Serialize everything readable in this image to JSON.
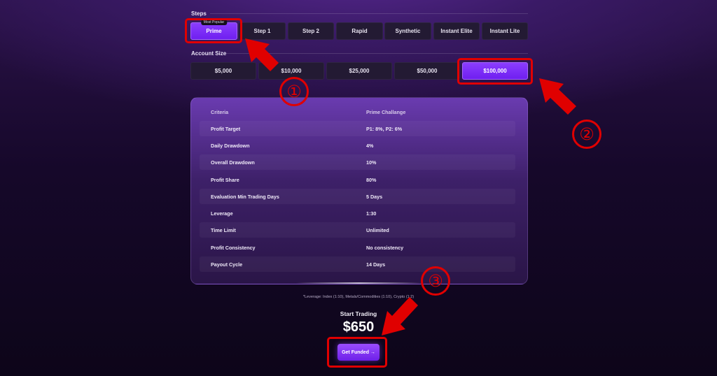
{
  "steps": {
    "label": "Steps",
    "badge": "Most Popular",
    "items": [
      "Prime",
      "Step 1",
      "Step 2",
      "Rapid",
      "Synthetic",
      "Instant Elite",
      "Instant Lite"
    ],
    "selected": "Prime"
  },
  "account_size": {
    "label": "Account Size",
    "items": [
      "$5,000",
      "$10,000",
      "$25,000",
      "$50,000",
      "$100,000"
    ],
    "selected": "$100,000"
  },
  "table": {
    "headers": [
      "Criteria",
      "Prime Challange"
    ],
    "rows": [
      [
        "Profit Target",
        "P1: 8%, P2: 6%"
      ],
      [
        "Daily Drawdown",
        "4%"
      ],
      [
        "Overall Drawdown",
        "10%"
      ],
      [
        "Profit Share",
        "80%"
      ],
      [
        "Evaluation Min Trading Days",
        "5 Days"
      ],
      [
        "Leverage",
        "1:30"
      ],
      [
        "Time Limit",
        "Unlimited"
      ],
      [
        "Profit Consistency",
        "No consistency"
      ],
      [
        "Payout Cycle",
        "14 Days"
      ]
    ]
  },
  "footnote": "*Leverage: Index (1:10), Metals/Commodities (1:10), Crypto (1:2)",
  "start_trading": {
    "label": "Start Trading",
    "price": "$650"
  },
  "cta": {
    "label": "Get Funded →"
  },
  "annotations": {
    "markers": [
      "①",
      "②",
      "③"
    ]
  },
  "colors": {
    "accent": "#7b2cff",
    "highlight": "#e00000",
    "button_bg": "#231a33"
  }
}
